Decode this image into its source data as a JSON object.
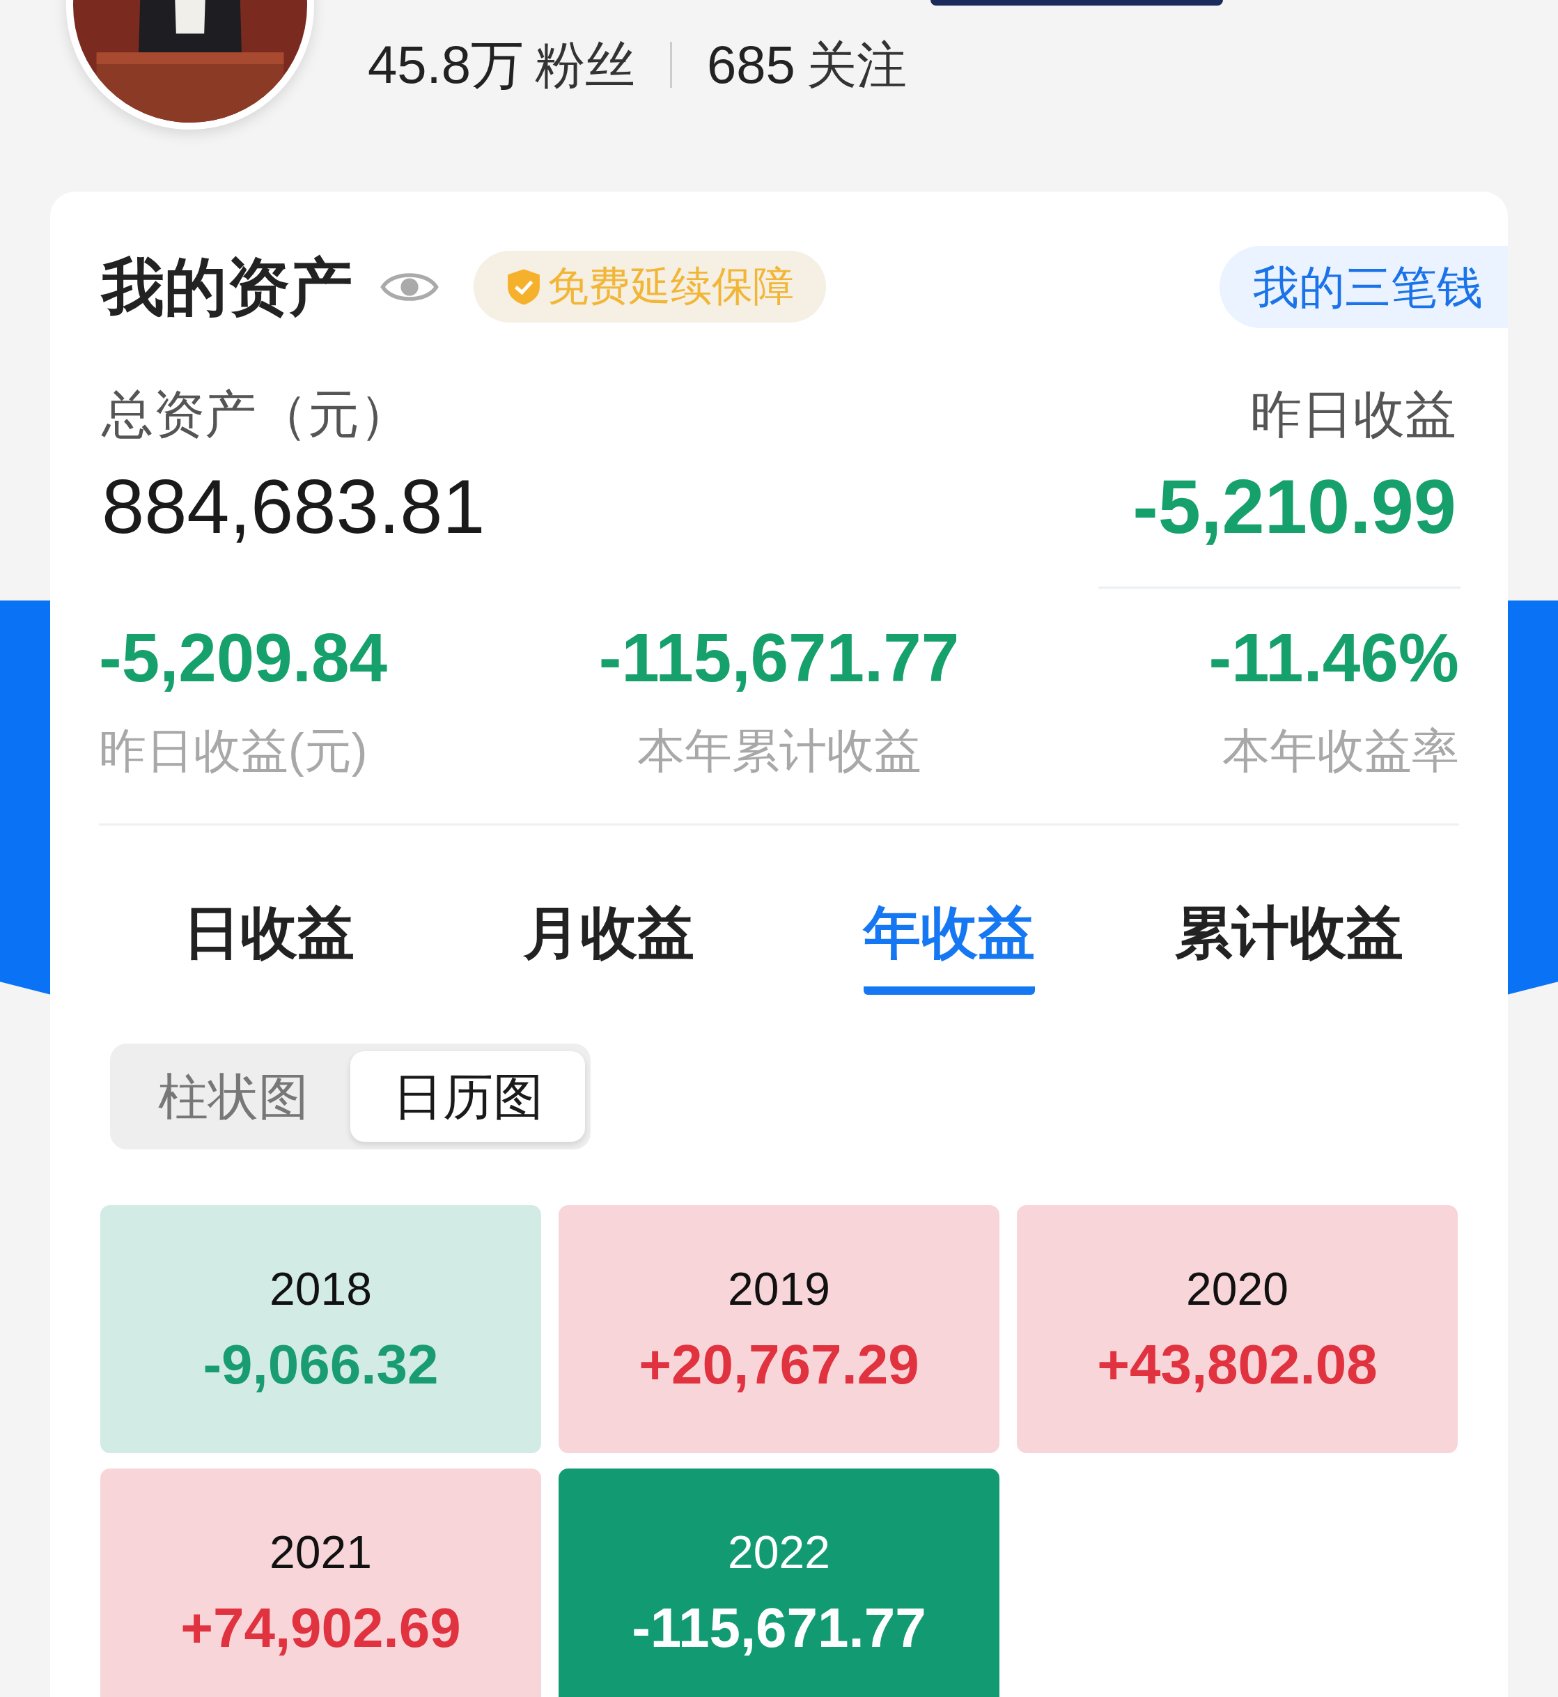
{
  "profile": {
    "followers_count": "45.8万",
    "followers_label": "粉丝",
    "following_count": "685",
    "following_label": "关注"
  },
  "assets": {
    "title": "我的资产",
    "badge": "免费延续保障",
    "link": "我的三笔钱",
    "total_label": "总资产（元）",
    "total_value": "884,683.81",
    "yesterday_label": "昨日收益",
    "yesterday_value": "-5,210.99"
  },
  "stats": [
    {
      "value": "-5,209.84",
      "label": "昨日收益(元)"
    },
    {
      "value": "-115,671.77",
      "label": "本年累计收益"
    },
    {
      "value": "-11.46%",
      "label": "本年收益率"
    }
  ],
  "tabs": [
    {
      "label": "日收益",
      "selected": false
    },
    {
      "label": "月收益",
      "selected": false
    },
    {
      "label": "年收益",
      "selected": true
    },
    {
      "label": "累计收益",
      "selected": false
    }
  ],
  "view_toggle": [
    {
      "label": "柱状图",
      "selected": false
    },
    {
      "label": "日历图",
      "selected": true
    }
  ],
  "years": [
    {
      "year": "2018",
      "value": "-9,066.32",
      "kind": "loss",
      "selected": false
    },
    {
      "year": "2019",
      "value": "+20,767.29",
      "kind": "gain",
      "selected": false
    },
    {
      "year": "2020",
      "value": "+43,802.08",
      "kind": "gain",
      "selected": false
    },
    {
      "year": "2021",
      "value": "+74,902.69",
      "kind": "gain",
      "selected": false
    },
    {
      "year": "2022",
      "value": "-115,671.77",
      "kind": "loss",
      "selected": true
    }
  ]
}
